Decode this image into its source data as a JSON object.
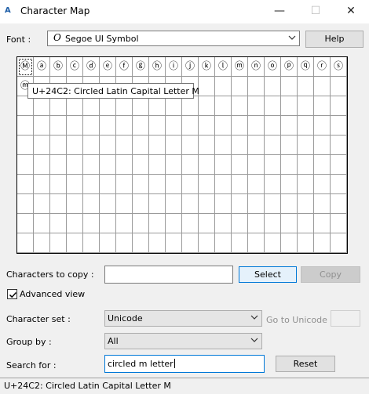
{
  "window": {
    "title": "Character Map",
    "icon": "character-map-app-icon",
    "app_icon_glyph": "A",
    "min_glyph": "—",
    "max_glyph": "☐",
    "close_glyph": "✕"
  },
  "font": {
    "label": "Font :",
    "value": "Segoe UI Symbol",
    "type_glyph": "O",
    "help_label": "Help"
  },
  "grid": {
    "row0": [
      "Ⓜ",
      "ⓐ",
      "ⓑ",
      "ⓒ",
      "ⓓ",
      "ⓔ",
      "ⓕ",
      "ⓖ",
      "ⓗ",
      "ⓘ",
      "ⓙ",
      "ⓚ",
      "ⓛ",
      "ⓜ",
      "ⓝ",
      "ⓞ",
      "ⓟ",
      "ⓠ",
      "ⓡ",
      "ⓢ"
    ],
    "row1": [
      "ⓜ",
      "",
      "",
      "",
      "",
      "",
      "",
      "",
      "",
      "",
      "",
      "",
      "",
      "",
      "",
      "",
      "",
      "",
      "",
      ""
    ],
    "tooltip": "U+24C2: Circled Latin Capital Letter M"
  },
  "copy": {
    "label": "Characters to copy :",
    "value": "",
    "select_label": "Select",
    "copy_label": "Copy"
  },
  "advanced_view": {
    "label": "Advanced view",
    "checked": true
  },
  "character_set": {
    "label": "Character set :",
    "value": "Unicode"
  },
  "goto_unicode": {
    "label": "Go to Unicode :",
    "value": ""
  },
  "group_by": {
    "label": "Group by :",
    "value": "All"
  },
  "search": {
    "label": "Search for :",
    "value": "circled m letter",
    "reset_label": "Reset"
  },
  "status": {
    "text": "U+24C2: Circled Latin Capital Letter M"
  }
}
